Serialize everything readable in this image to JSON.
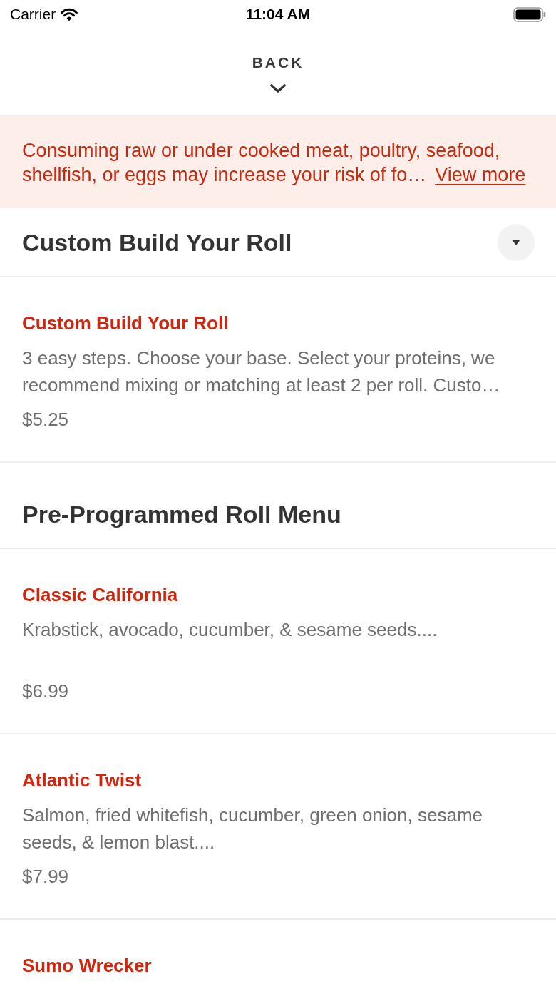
{
  "status_bar": {
    "carrier": "Carrier",
    "time": "11:04 AM"
  },
  "back_button": {
    "label": "BACK"
  },
  "warning": {
    "text": "Consuming raw or under cooked meat, poultry, seafood, shellfish, or eggs may increase your risk of fo…",
    "link": "View more"
  },
  "sections": [
    {
      "title": "Custom Build Your Roll",
      "collapse_button": true,
      "items": [
        {
          "name": "Custom Build Your Roll",
          "description": "3 easy steps. Choose your base. Select your proteins, we recommend mixing or matching at least 2 per roll. Custo…",
          "price": "$5.25"
        }
      ]
    },
    {
      "title": "Pre-Programmed Roll Menu",
      "items": [
        {
          "name": "Classic California",
          "description": "Krabstick, avocado, cucumber, & sesame seeds....",
          "price": "$6.99"
        },
        {
          "name": "Atlantic Twist",
          "description": "Salmon, fried whitefish, cucumber, green onion, sesame seeds, & lemon blast....",
          "price": "$7.99"
        },
        {
          "name": "Sumo Wrecker"
        }
      ]
    }
  ]
}
